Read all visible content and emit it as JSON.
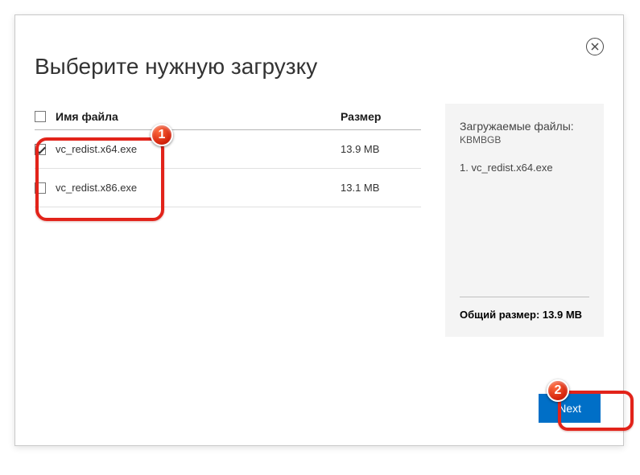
{
  "title": "Выберите нужную загрузку",
  "columns": {
    "name": "Имя файла",
    "size": "Размер"
  },
  "files": [
    {
      "name": "vc_redist.x64.exe",
      "size": "13.9 MB",
      "checked": true
    },
    {
      "name": "vc_redist.x86.exe",
      "size": "13.1 MB",
      "checked": false
    }
  ],
  "sidebar": {
    "title": "Загружаемые файлы:",
    "units": "KBMBGB",
    "items": [
      "1. vc_redist.x64.exe"
    ],
    "total_label": "Общий размер:",
    "total_value": "13.9 MB"
  },
  "next_label": "Next",
  "annotations": {
    "badge1": "1",
    "badge2": "2"
  }
}
